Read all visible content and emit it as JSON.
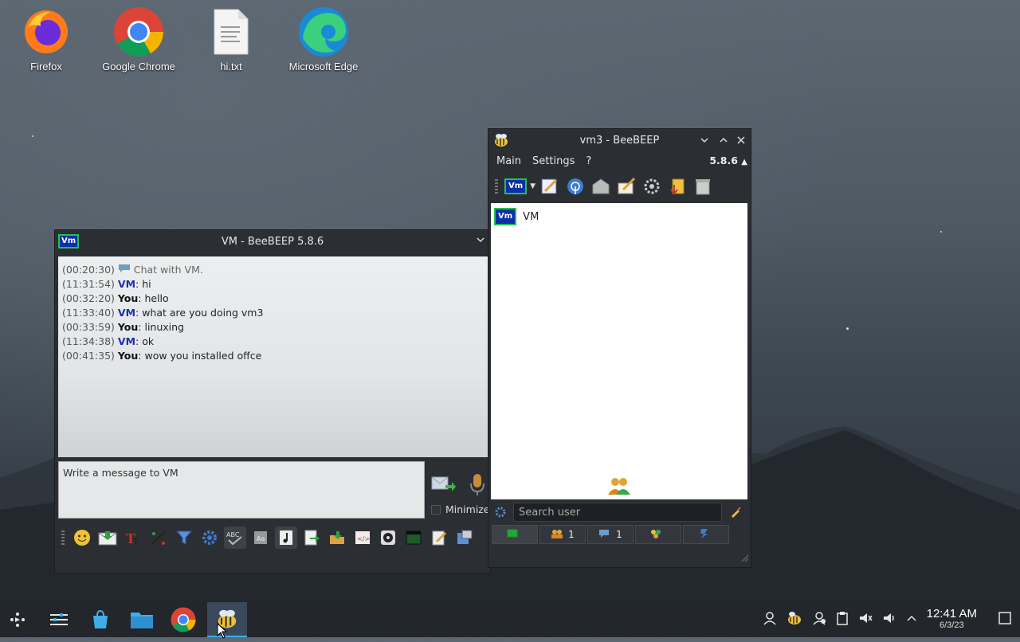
{
  "desktop": {
    "icons": [
      {
        "label": "Firefox"
      },
      {
        "label": "Google Chrome"
      },
      {
        "label": "hi.txt"
      },
      {
        "label": "Microsoft Edge"
      }
    ]
  },
  "chat_window": {
    "title": "VM - BeeBEEP 5.8.6",
    "badge": "Vm",
    "messages": [
      {
        "time": "(00:20:30)",
        "sender": "",
        "text": "Chat with VM."
      },
      {
        "time": "(11:31:54)",
        "sender": "VM",
        "text": ": hi"
      },
      {
        "time": "(00:32:20)",
        "sender": "You",
        "text": ": hello"
      },
      {
        "time": "(11:33:40)",
        "sender": "VM",
        "text": ": what are you doing vm3"
      },
      {
        "time": "(00:33:59)",
        "sender": "You",
        "text": ": linuxing"
      },
      {
        "time": "(11:34:38)",
        "sender": "VM",
        "text": ": ok"
      },
      {
        "time": "(00:41:35)",
        "sender": "You",
        "text": ": wow you installed offce"
      }
    ],
    "input_placeholder": "Write a message to VM",
    "minimize_label": "Minimize"
  },
  "main_window": {
    "title": "vm3 - BeeBEEP",
    "menu": [
      "Main",
      "Settings",
      "?"
    ],
    "version": "5.8.6",
    "status_badge": "Vm",
    "users": [
      {
        "badge": "Vm",
        "name": "VM"
      }
    ],
    "search_placeholder": "Search user",
    "tabs": [
      {
        "icon": "monitor-icon",
        "count": ""
      },
      {
        "icon": "users-icon",
        "count": "1"
      },
      {
        "icon": "chat-icon",
        "count": "1"
      },
      {
        "icon": "groups-icon",
        "count": ""
      },
      {
        "icon": "share-icon",
        "count": ""
      }
    ]
  },
  "taskbar": {
    "time": "12:41 AM",
    "date": "6/3/23"
  },
  "colors": {
    "accent": "#3daee9",
    "vm_badge": "#0b2fa8",
    "badge_border": "#22c34a"
  }
}
